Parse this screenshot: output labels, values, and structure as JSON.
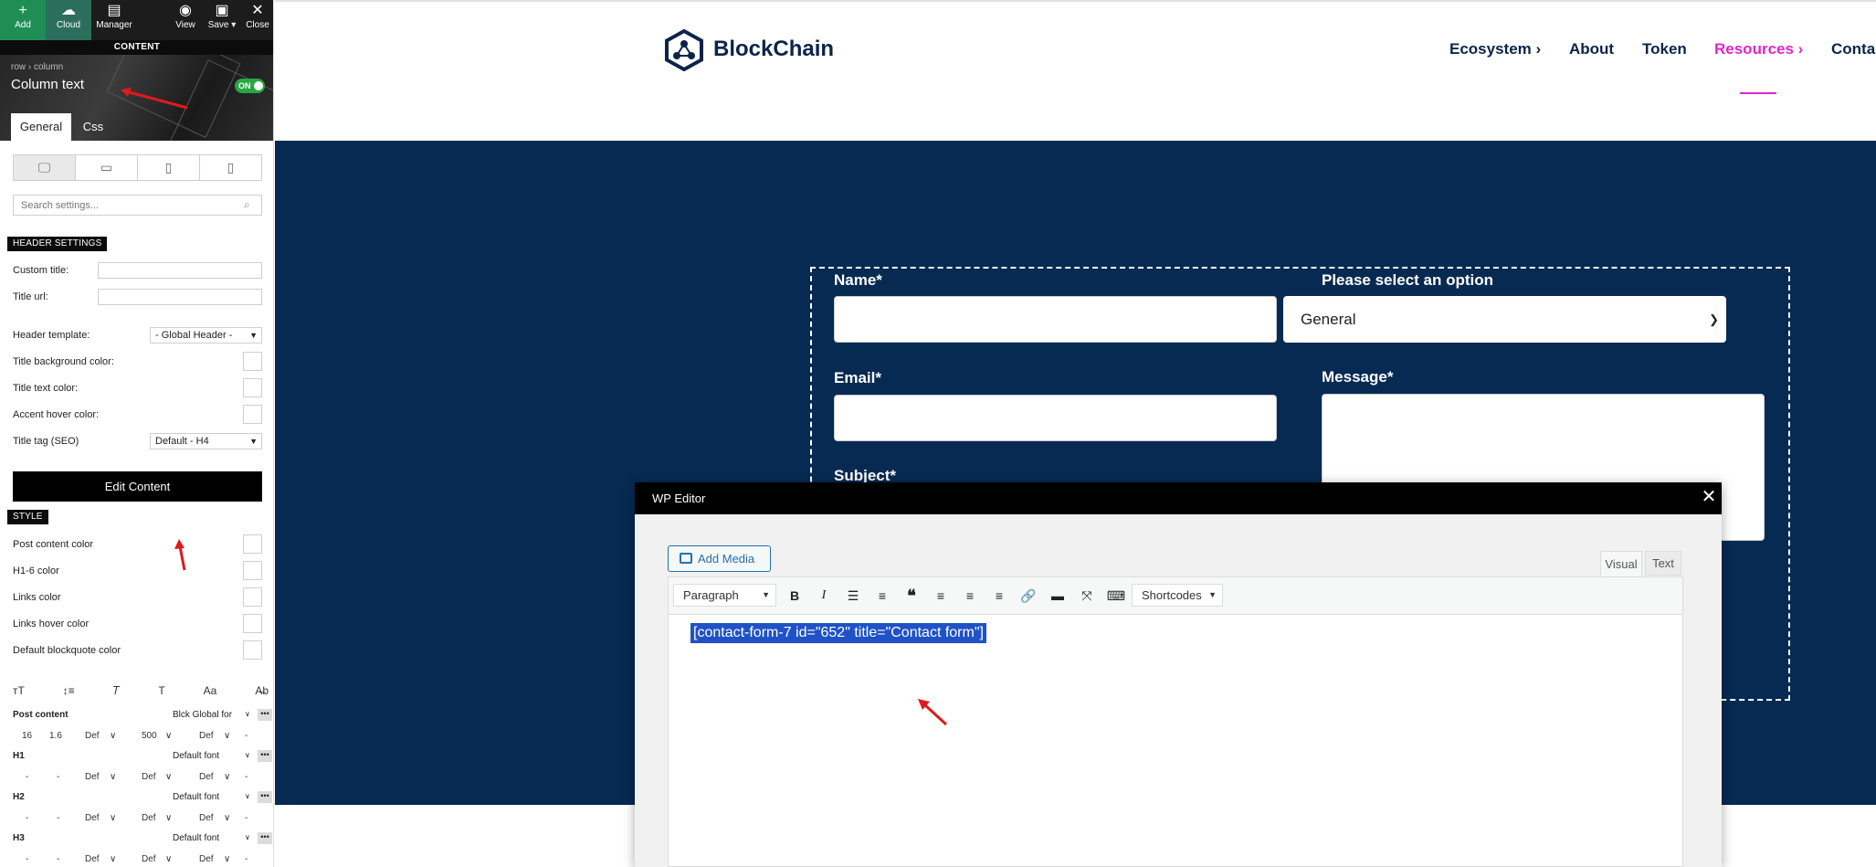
{
  "builder": {
    "toolbar": {
      "add": "Add",
      "cloud": "Cloud",
      "manager": "Manager",
      "view": "View",
      "save": "Save",
      "close": "Close"
    },
    "content_label": "CONTENT",
    "breadcrumb": "row  ›  column",
    "element_title": "Column text",
    "toggle": "ON",
    "tabs": [
      "General",
      "Css"
    ],
    "search_placeholder": "Search settings...",
    "header_settings_title": "HEADER SETTINGS",
    "custom_title_label": "Custom title:",
    "title_url_label": "Title url:",
    "header_template_label": "Header template:",
    "header_template_value": "- Global Header -",
    "title_bg_color_label": "Title background color:",
    "title_text_color_label": "Title text color:",
    "accent_hover_color_label": "Accent hover color:",
    "title_tag_label": "Title tag (SEO)",
    "title_tag_value": "Default - H4",
    "edit_content_button": "Edit Content",
    "style_title": "STYLE",
    "style_colors": [
      "Post content color",
      "H1-6 color",
      "Links color",
      "Links hover color",
      "Default blockquote color"
    ],
    "typography": {
      "post_content": {
        "label": "Post content",
        "font": "Blck Global for",
        "size": "16",
        "line_height": "1.6",
        "letter": "Def",
        "weight": "500",
        "transform": "Def",
        "dash": "-"
      },
      "h1": {
        "label": "H1",
        "font": "Default font",
        "size": "-",
        "line_height": "-",
        "letter": "Def",
        "weight": "Def",
        "transform": "Def",
        "dash": "-"
      },
      "h2": {
        "label": "H2",
        "font": "Default font",
        "size": "-",
        "line_height": "-",
        "letter": "Def",
        "weight": "Def",
        "transform": "Def",
        "dash": "-"
      },
      "h3": {
        "label": "H3",
        "font": "Default font",
        "size": "-",
        "line_height": "-",
        "letter": "Def",
        "weight": "Def",
        "transform": "Def",
        "dash": "-"
      }
    },
    "typo_icons": [
      "ᴛT",
      "↕≡",
      "𝑇",
      "T",
      "Aa",
      "A̶b"
    ]
  },
  "site": {
    "logo": "BlockChain",
    "nav": [
      "Ecosystem ›",
      "About",
      "Token",
      "Resources ›",
      "Conta"
    ],
    "form": {
      "name_label": "Name*",
      "select_label": "Please select an option",
      "select_value": "General",
      "email_label": "Email*",
      "message_label": "Message*",
      "subject_label": "Subject*"
    },
    "colors": {
      "hero_bg": "#072a52",
      "accent": "#e026c7",
      "brand": "#0c2449"
    }
  },
  "wp_editor": {
    "title": "WP Editor",
    "add_media": "Add Media",
    "tabs": [
      "Visual",
      "Text"
    ],
    "format": "Paragraph",
    "shortcodes": "Shortcodes",
    "content": "[contact-form-7 id=\"652\" title=\"Contact form\"]"
  }
}
